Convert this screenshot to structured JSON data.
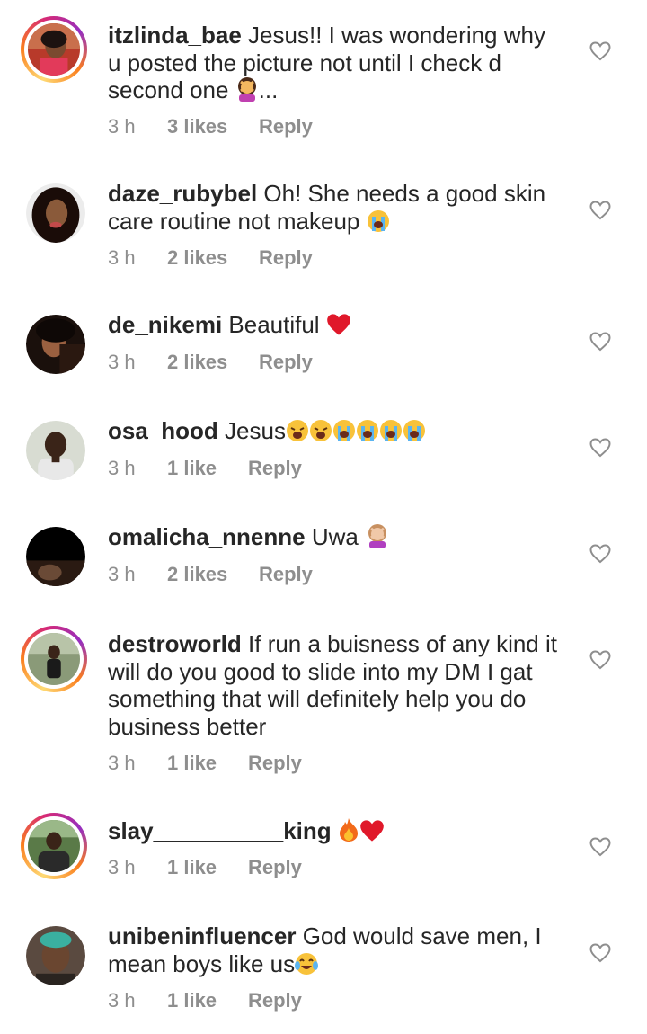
{
  "comments": [
    {
      "username": "itzlinda_bae",
      "text": " Jesus!! I was wondering why u posted the picture not until I check d second one ",
      "suffix": "...",
      "emoji": [
        "woman-gesturing-no"
      ],
      "time": "3 h",
      "likes": "3 likes",
      "reply": "Reply",
      "avatar_bg": "#c89a7a"
    },
    {
      "username": "daze_rubybel",
      "text": " Oh! She needs a good skin care routine not makeup ",
      "suffix": "",
      "emoji": [
        "loudly-crying-face"
      ],
      "time": "3 h",
      "likes": "2 likes",
      "reply": "Reply",
      "avatar_bg": "#2a1a14"
    },
    {
      "username": "de_nikemi",
      "text": " Beautiful ",
      "suffix": "",
      "emoji": [
        "red-heart"
      ],
      "time": "3 h",
      "likes": "2 likes",
      "reply": "Reply",
      "avatar_bg": "#3b2418"
    },
    {
      "username": "osa_hood",
      "text": " Jesus",
      "suffix": "",
      "emoji": [
        "weary-face",
        "weary-face",
        "loudly-crying-face",
        "loudly-crying-face",
        "loudly-crying-face",
        "loudly-crying-face"
      ],
      "time": "3 h",
      "likes": "1 like",
      "reply": "Reply",
      "avatar_bg": "#a9b59a"
    },
    {
      "username": "omalicha_nnenne",
      "text": " Uwa ",
      "suffix": "",
      "emoji": [
        "woman-gesturing-no-light"
      ],
      "time": "3 h",
      "likes": "2 likes",
      "reply": "Reply",
      "avatar_bg": "#000000"
    },
    {
      "username": "destroworld",
      "text": " If run a buisness of any kind it will do you good to slide into my DM I gat something that will definitely help you do business better",
      "suffix": "",
      "emoji": [],
      "time": "3 h",
      "likes": "1 like",
      "reply": "Reply",
      "avatar_bg": "#7a8a6a"
    },
    {
      "username": "slay__________king",
      "text": " ",
      "suffix": "",
      "emoji": [
        "fire",
        "red-heart"
      ],
      "time": "3 h",
      "likes": "1 like",
      "reply": "Reply",
      "avatar_bg": "#6f8a5a"
    },
    {
      "username": "unibeninfluencer",
      "text": " God would save men, I mean boys like us",
      "suffix": "",
      "emoji": [
        "face-with-tears-of-joy"
      ],
      "time": "3 h",
      "likes": "1 like",
      "reply": "Reply",
      "avatar_bg": "#4a3a30"
    }
  ],
  "colors": {
    "text": "#262626",
    "meta": "#8e8e8e",
    "heart_outline": "#8e8e8e"
  },
  "icons": {
    "like": "heart-outline-icon"
  }
}
